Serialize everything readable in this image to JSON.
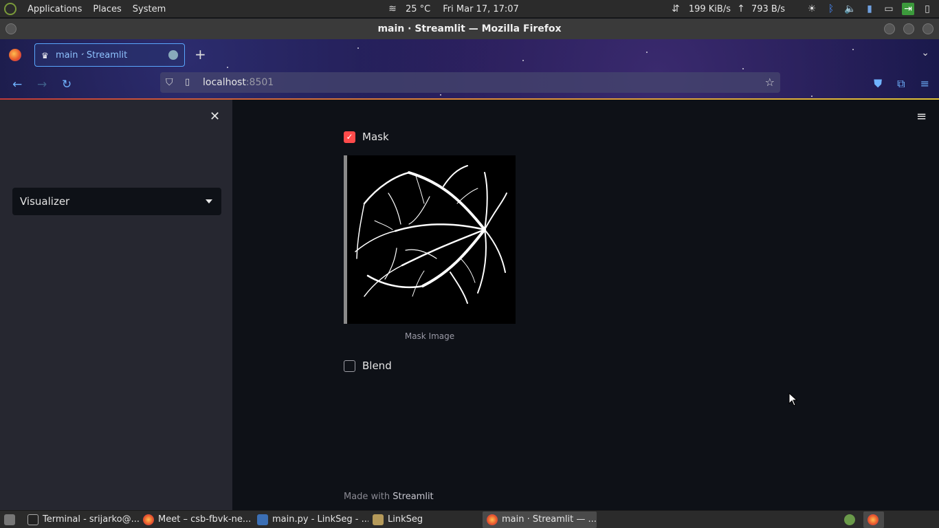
{
  "system_panel": {
    "menus": [
      "Applications",
      "Places",
      "System"
    ],
    "weather": "25 °C",
    "datetime": "Fri Mar 17, 17:07",
    "net_down": "199 KiB/s",
    "net_up": "793 B/s"
  },
  "window": {
    "title": "main · Streamlit — Mozilla Firefox"
  },
  "browser": {
    "tab_label": "main · Streamlit",
    "url_host": "localhost",
    "url_port": ":8501"
  },
  "sidebar": {
    "select_value": "Visualizer"
  },
  "main": {
    "mask_checkbox": {
      "label": "Mask",
      "checked": true
    },
    "image_caption": "Mask Image",
    "blend_checkbox": {
      "label": "Blend",
      "checked": false
    },
    "footer_prefix": "Made with",
    "footer_brand": "Streamlit"
  },
  "taskbar": {
    "items": [
      {
        "label": "Terminal - srijarko@..."
      },
      {
        "label": "Meet – csb-fbvk-ne..."
      },
      {
        "label": "main.py - LinkSeg - ..."
      },
      {
        "label": "LinkSeg"
      },
      {
        "label": "main · Streamlit — ..."
      }
    ]
  },
  "colors": {
    "accent_red": "#ff4b4b",
    "page_bg": "#0e1117",
    "sidebar_bg": "#262730",
    "link_blue": "#6fb3ff"
  }
}
